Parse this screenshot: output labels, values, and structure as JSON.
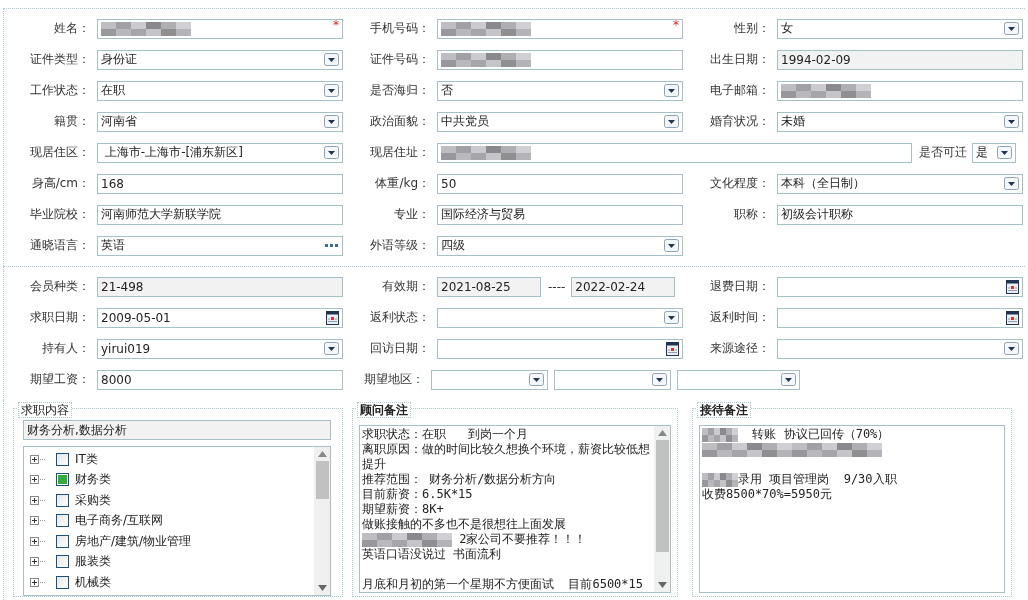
{
  "sections": [
    {
      "rows": [
        [
          {
            "label": "姓名：",
            "field": {
              "kind": "text",
              "redacted": true,
              "required_mark": "*"
            }
          },
          {
            "label": "手机号码：",
            "field": {
              "kind": "text",
              "redacted": true,
              "required_mark": "*"
            }
          },
          {
            "label": "性别：",
            "field": {
              "kind": "select",
              "value": "女"
            }
          }
        ],
        [
          {
            "label": "证件类型：",
            "field": {
              "kind": "select",
              "value": "身份证"
            }
          },
          {
            "label": "证件号码：",
            "field": {
              "kind": "text",
              "redacted": true
            }
          },
          {
            "label": "出生日期：",
            "field": {
              "kind": "text",
              "value": "1994-02-09",
              "readonly": true
            }
          }
        ],
        [
          {
            "label": "工作状态：",
            "field": {
              "kind": "select",
              "value": "在职"
            }
          },
          {
            "label": "是否海归：",
            "field": {
              "kind": "select",
              "value": "否"
            }
          },
          {
            "label": "电子邮箱：",
            "field": {
              "kind": "text",
              "redacted": true
            }
          }
        ],
        [
          {
            "label": "籍贯：",
            "field": {
              "kind": "select",
              "value": "河南省"
            }
          },
          {
            "label": "政治面貌：",
            "field": {
              "kind": "select",
              "value": "中共党员"
            }
          },
          {
            "label": "婚育状况：",
            "field": {
              "kind": "select",
              "value": "未婚"
            }
          }
        ],
        [
          {
            "label": "现居住区：",
            "field": {
              "kind": "select",
              "value": " 上海市-上海市-[浦东新区]"
            }
          },
          {
            "label": "现居住址：",
            "wide": true,
            "field": {
              "kind": "text",
              "redacted": true
            }
          },
          {
            "label": "是否可迁",
            "compact": true,
            "field": {
              "kind": "select",
              "value": "是"
            }
          }
        ],
        [
          {
            "label": "身高/cm：",
            "field": {
              "kind": "text",
              "value": "168"
            }
          },
          {
            "label": "体重/kg：",
            "field": {
              "kind": "text",
              "value": "50"
            }
          },
          {
            "label": "文化程度：",
            "field": {
              "kind": "select",
              "value": "本科（全日制）"
            }
          }
        ],
        [
          {
            "label": "毕业院校：",
            "field": {
              "kind": "text",
              "value": "河南师范大学新联学院"
            }
          },
          {
            "label": "专业：",
            "field": {
              "kind": "text",
              "value": "国际经济与贸易"
            }
          },
          {
            "label": "职称：",
            "field": {
              "kind": "text",
              "value": "初级会计职称"
            }
          }
        ],
        [
          {
            "label": "通晓语言：",
            "field": {
              "kind": "more",
              "value": "英语"
            }
          },
          {
            "label": "外语等级：",
            "field": {
              "kind": "select",
              "value": "四级"
            }
          }
        ]
      ]
    },
    {
      "rows": [
        [
          {
            "label": "会员种类：",
            "field": {
              "kind": "text",
              "value": "21-498",
              "readonly": true
            }
          },
          {
            "label": "有效期：",
            "field": {
              "kind": "range",
              "from": "2021-08-25",
              "separator": "----",
              "to": "2022-02-24",
              "readonly": true
            }
          },
          {
            "label": "退费日期：",
            "field": {
              "kind": "date"
            }
          }
        ],
        [
          {
            "label": "求职日期：",
            "field": {
              "kind": "date",
              "value": "2009-05-01"
            }
          },
          {
            "label": "返利状态：",
            "field": {
              "kind": "select"
            }
          },
          {
            "label": "返利时间：",
            "field": {
              "kind": "date"
            }
          }
        ],
        [
          {
            "label": "持有人：",
            "field": {
              "kind": "select",
              "value": "yirui019"
            }
          },
          {
            "label": "回访日期：",
            "field": {
              "kind": "date"
            }
          },
          {
            "label": "来源途径：",
            "field": {
              "kind": "select"
            }
          }
        ],
        [
          {
            "label": "期望工资：",
            "field": {
              "kind": "text",
              "value": "8000"
            }
          },
          {
            "label": "期望地区：",
            "field": {
              "kind": "multi",
              "parts": [
                {
                  "kind": "select"
                },
                {
                  "kind": "select"
                },
                {
                  "kind": "select"
                }
              ]
            }
          }
        ]
      ]
    }
  ],
  "job_content": {
    "legend": "求职内容",
    "summary": "财务分析,数据分析",
    "tree": [
      {
        "label": "IT类",
        "checked": false,
        "expanded": false
      },
      {
        "label": "财务类",
        "checked": true,
        "expanded": false
      },
      {
        "label": "采购类",
        "checked": false,
        "expanded": false
      },
      {
        "label": "电子商务/互联网",
        "checked": false,
        "expanded": false
      },
      {
        "label": "房地产/建筑/物业管理",
        "checked": false,
        "expanded": false
      },
      {
        "label": "服装类",
        "checked": false,
        "expanded": false
      },
      {
        "label": "机械类",
        "checked": false,
        "expanded": false
      }
    ]
  },
  "notes": [
    {
      "legend": "顾问备注",
      "scrollbar": true,
      "lines": [
        {
          "segments": [
            {
              "kind": "text",
              "text": "求职状态：在职   到岗一个月"
            }
          ]
        },
        {
          "segments": [
            {
              "kind": "text",
              "text": "离职原因：做的时间比较久想换个环境，薪资比较低想提升"
            }
          ]
        },
        {
          "segments": [
            {
              "kind": "text",
              "text": "推荐范围： 财务分析/数据分析方向"
            }
          ]
        },
        {
          "segments": [
            {
              "kind": "text",
              "text": "目前薪资：6.5K*15"
            }
          ]
        },
        {
          "segments": [
            {
              "kind": "text",
              "text": "期望薪资：8K+"
            }
          ]
        },
        {
          "segments": [
            {
              "kind": "text",
              "text": "做账接触的不多也不是很想往上面发展"
            }
          ]
        },
        {
          "segments": [
            {
              "kind": "blur_long"
            },
            {
              "kind": "text",
              "text": " 2家公司不要推荐！！！"
            }
          ]
        },
        {
          "segments": [
            {
              "kind": "text",
              "text": "英语口语没说过 书面流利"
            }
          ]
        },
        {
          "kind": "blank"
        },
        {
          "segments": [
            {
              "kind": "text",
              "text": "月底和月初的第一个星期不方便面试  目前6500*15"
            }
          ]
        }
      ]
    },
    {
      "legend": "接待备注",
      "scrollbar": false,
      "lines": [
        {
          "segments": [
            {
              "kind": "blur_short"
            },
            {
              "kind": "text",
              "text": "  转账 协议已回传（70%）"
            }
          ]
        },
        {
          "segments": [
            {
              "kind": "blur_long"
            },
            {
              "kind": "blur_long"
            }
          ]
        },
        {
          "kind": "blank"
        },
        {
          "segments": [
            {
              "kind": "blur_short"
            },
            {
              "kind": "text",
              "text": "录用 项目管理岗  9/30入职"
            }
          ]
        },
        {
          "segments": [
            {
              "kind": "text",
              "text": "收费8500*70%=5950元"
            }
          ]
        }
      ]
    }
  ]
}
